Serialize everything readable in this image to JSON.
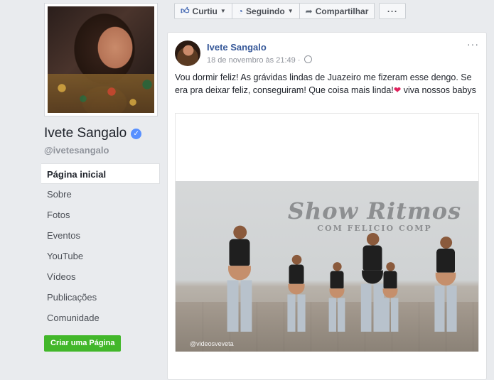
{
  "page": {
    "name": "Ivete Sangalo",
    "handle": "@ivetesangalo"
  },
  "nav": [
    {
      "label": "Página inicial",
      "active": true
    },
    {
      "label": "Sobre"
    },
    {
      "label": "Fotos"
    },
    {
      "label": "Eventos"
    },
    {
      "label": "YouTube"
    },
    {
      "label": "Vídeos"
    },
    {
      "label": "Publicações"
    },
    {
      "label": "Comunidade"
    }
  ],
  "create_page_label": "Criar uma Página",
  "actions": {
    "like": "Curtiu",
    "following": "Seguindo",
    "share": "Compartilhar",
    "more": "···"
  },
  "post": {
    "author": "Ivete Sangalo",
    "timestamp": "18 de novembro às 21:49",
    "text_before_heart": "Vou dormir feliz! As grávidas lindas de Juazeiro me fizeram esse dengo. Se era pra deixar feliz, conseguiram! Que coisa mais linda!",
    "text_after_heart": " viva nossos babys",
    "menu": "···",
    "video": {
      "sign_line1": "Show Ritmos",
      "sign_line2": "COM FELICIO COMP",
      "watermark": "@videosveveta"
    }
  },
  "colors": {
    "link": "#365899",
    "create_button": "#42b72a",
    "verified": "#5890ff",
    "heart": "#e0245e"
  }
}
